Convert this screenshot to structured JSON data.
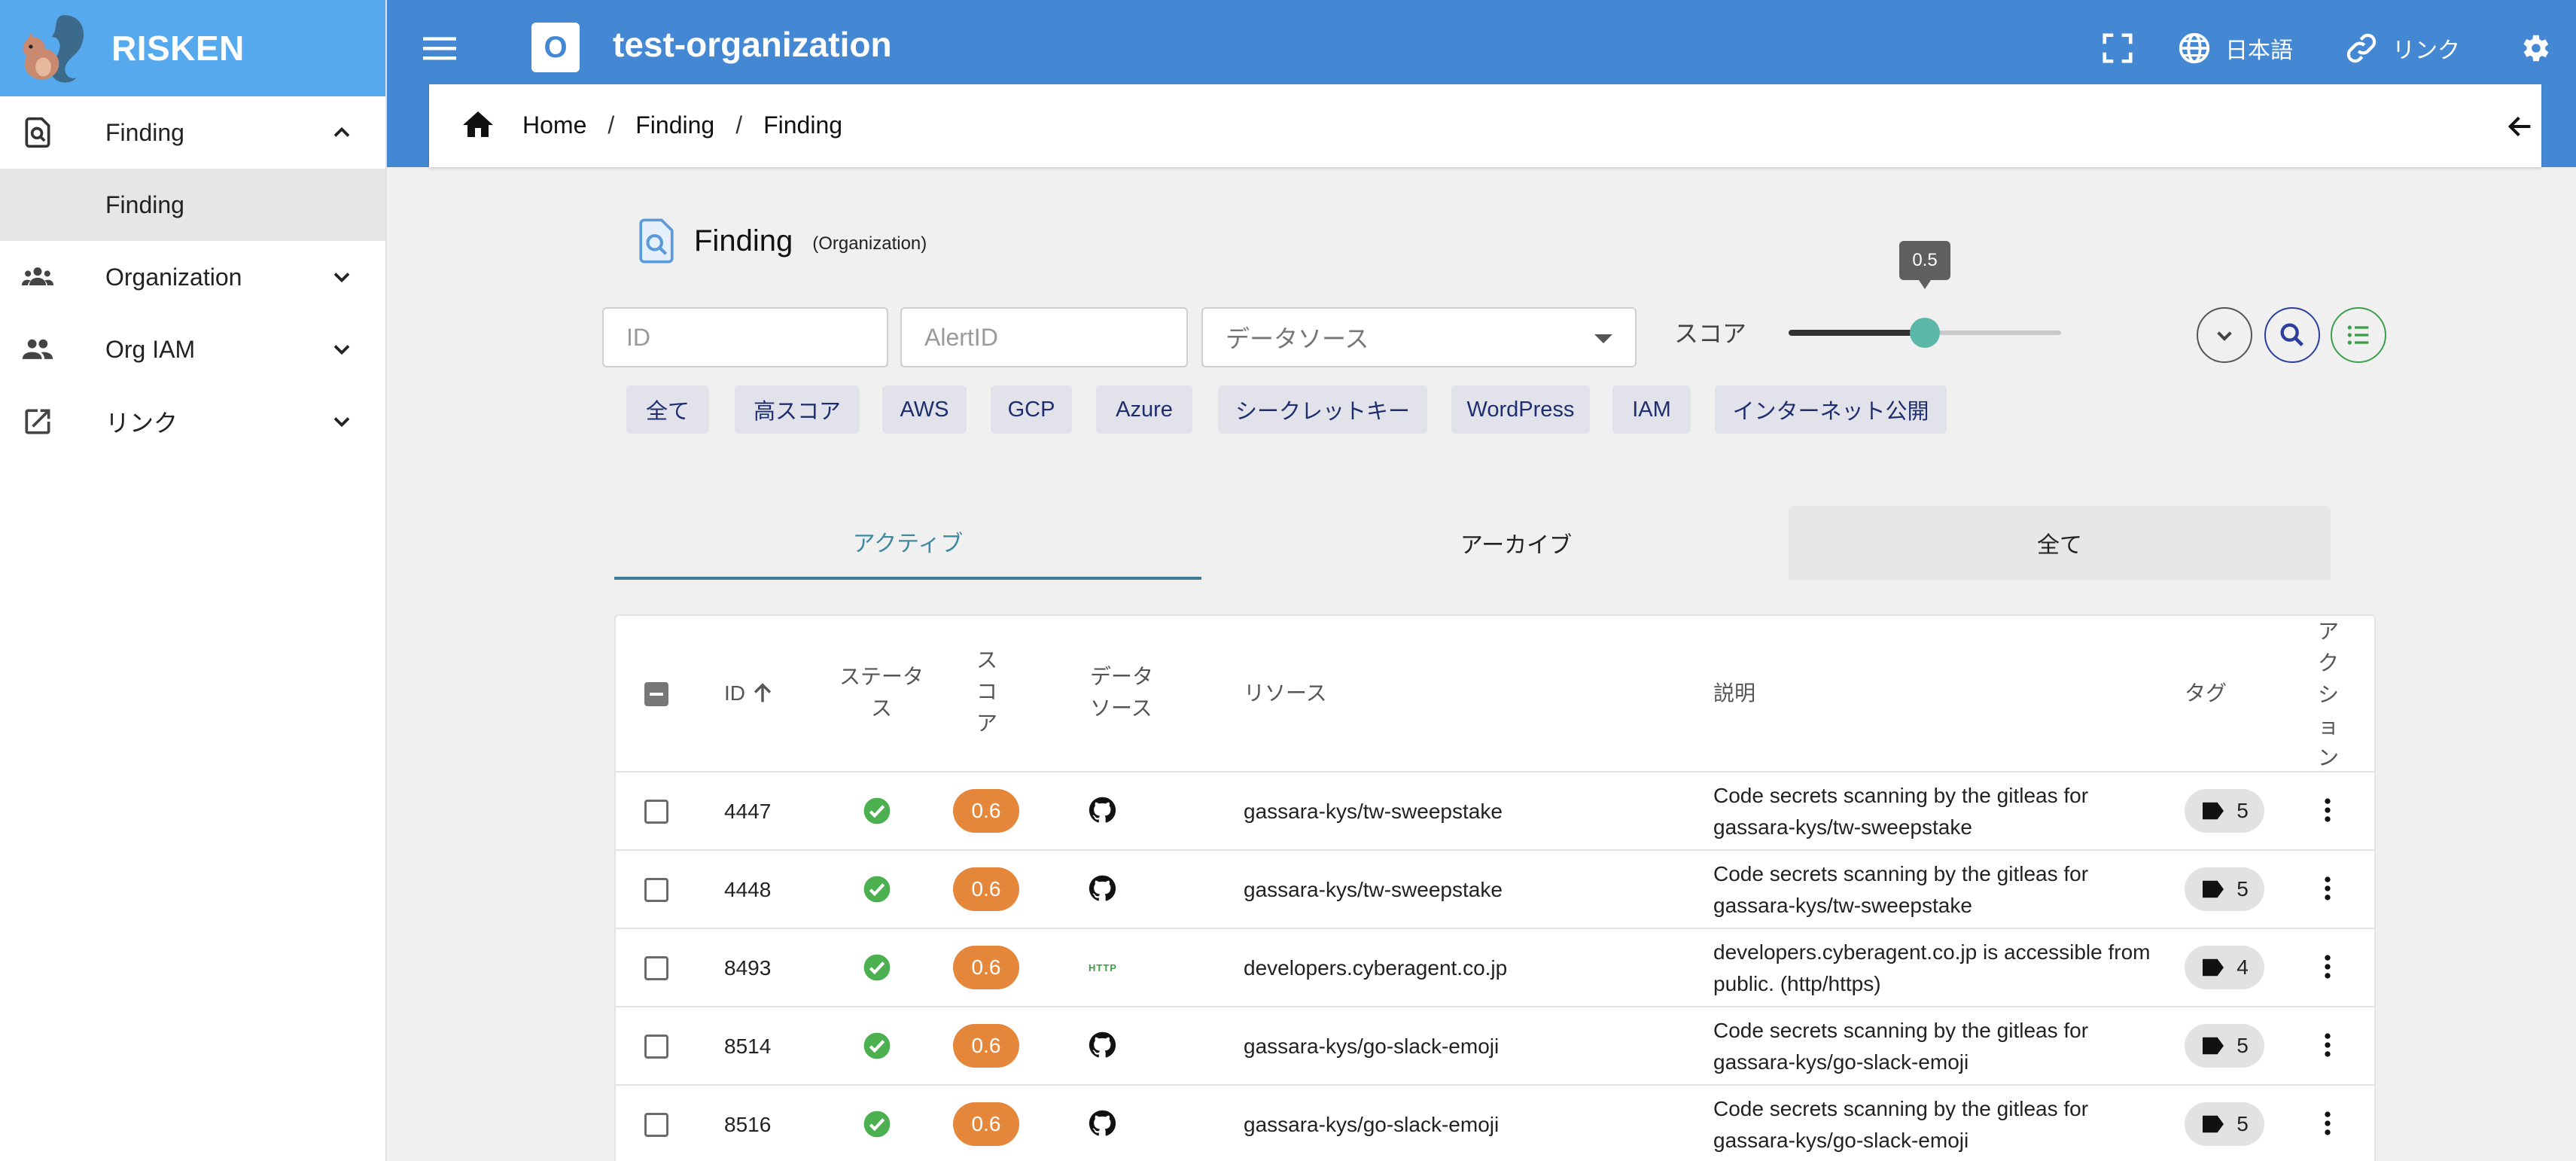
{
  "brand": {
    "name": "RISKEN"
  },
  "sidebar": {
    "items": [
      {
        "label": "Finding",
        "expanded": true,
        "children": [
          {
            "label": "Finding"
          }
        ]
      },
      {
        "label": "Organization"
      },
      {
        "label": "Org IAM"
      },
      {
        "label": "リンク"
      }
    ]
  },
  "header": {
    "org_badge": "O",
    "org_title": "test-organization",
    "language": "日本語",
    "link": "リンク"
  },
  "breadcrumb": [
    "Home",
    "Finding",
    "Finding"
  ],
  "page": {
    "title": "Finding",
    "subtitle": "(Organization)"
  },
  "filters": {
    "id_placeholder": "ID",
    "alert_id_placeholder": "AlertID",
    "datasource_placeholder": "データソース",
    "score_label": "スコア",
    "score_value": 0.5
  },
  "chips": [
    "全て",
    "高スコア",
    "AWS",
    "GCP",
    "Azure",
    "シークレットキー",
    "WordPress",
    "IAM",
    "インターネット公開"
  ],
  "tabs": [
    "アクティブ",
    "アーカイブ",
    "全て"
  ],
  "table": {
    "headers": {
      "id": "ID",
      "status": "ステータス",
      "score": "スコア",
      "datasource": "データソース",
      "resource": "リソース",
      "description": "説明",
      "tag": "タグ",
      "action": "アクション"
    },
    "rows": [
      {
        "id": "4447",
        "score": "0.6",
        "datasource_icon": "github-icon",
        "resource": "gassara-kys/tw-sweepstake",
        "description": "Code secrets scanning by the gitleas for gassara-kys/tw-sweepstake",
        "tags": "5"
      },
      {
        "id": "4448",
        "score": "0.6",
        "datasource_icon": "github-icon",
        "resource": "gassara-kys/tw-sweepstake",
        "description": "Code secrets scanning by the gitleas for gassara-kys/tw-sweepstake",
        "tags": "5"
      },
      {
        "id": "8493",
        "score": "0.6",
        "datasource_icon": "http-icon",
        "datasource_text": "HTTP",
        "resource": "developers.cyberagent.co.jp",
        "description": "developers.cyberagent.co.jp is accessible from public. (http/https)",
        "tags": "4"
      },
      {
        "id": "8514",
        "score": "0.6",
        "datasource_icon": "github-icon",
        "resource": "gassara-kys/go-slack-emoji",
        "description": "Code secrets scanning by the gitleas for gassara-kys/go-slack-emoji",
        "tags": "5"
      },
      {
        "id": "8516",
        "score": "0.6",
        "datasource_icon": "github-icon",
        "resource": "gassara-kys/go-slack-emoji",
        "description": "Code secrets scanning by the gitleas for gassara-kys/go-slack-emoji",
        "tags": "5"
      }
    ]
  },
  "colors": {
    "brand": "#57a9ee",
    "header": "#4488d4",
    "score": "#e4873a",
    "status_ok": "#4caf50",
    "slider_thumb": "#5bb7a8"
  }
}
